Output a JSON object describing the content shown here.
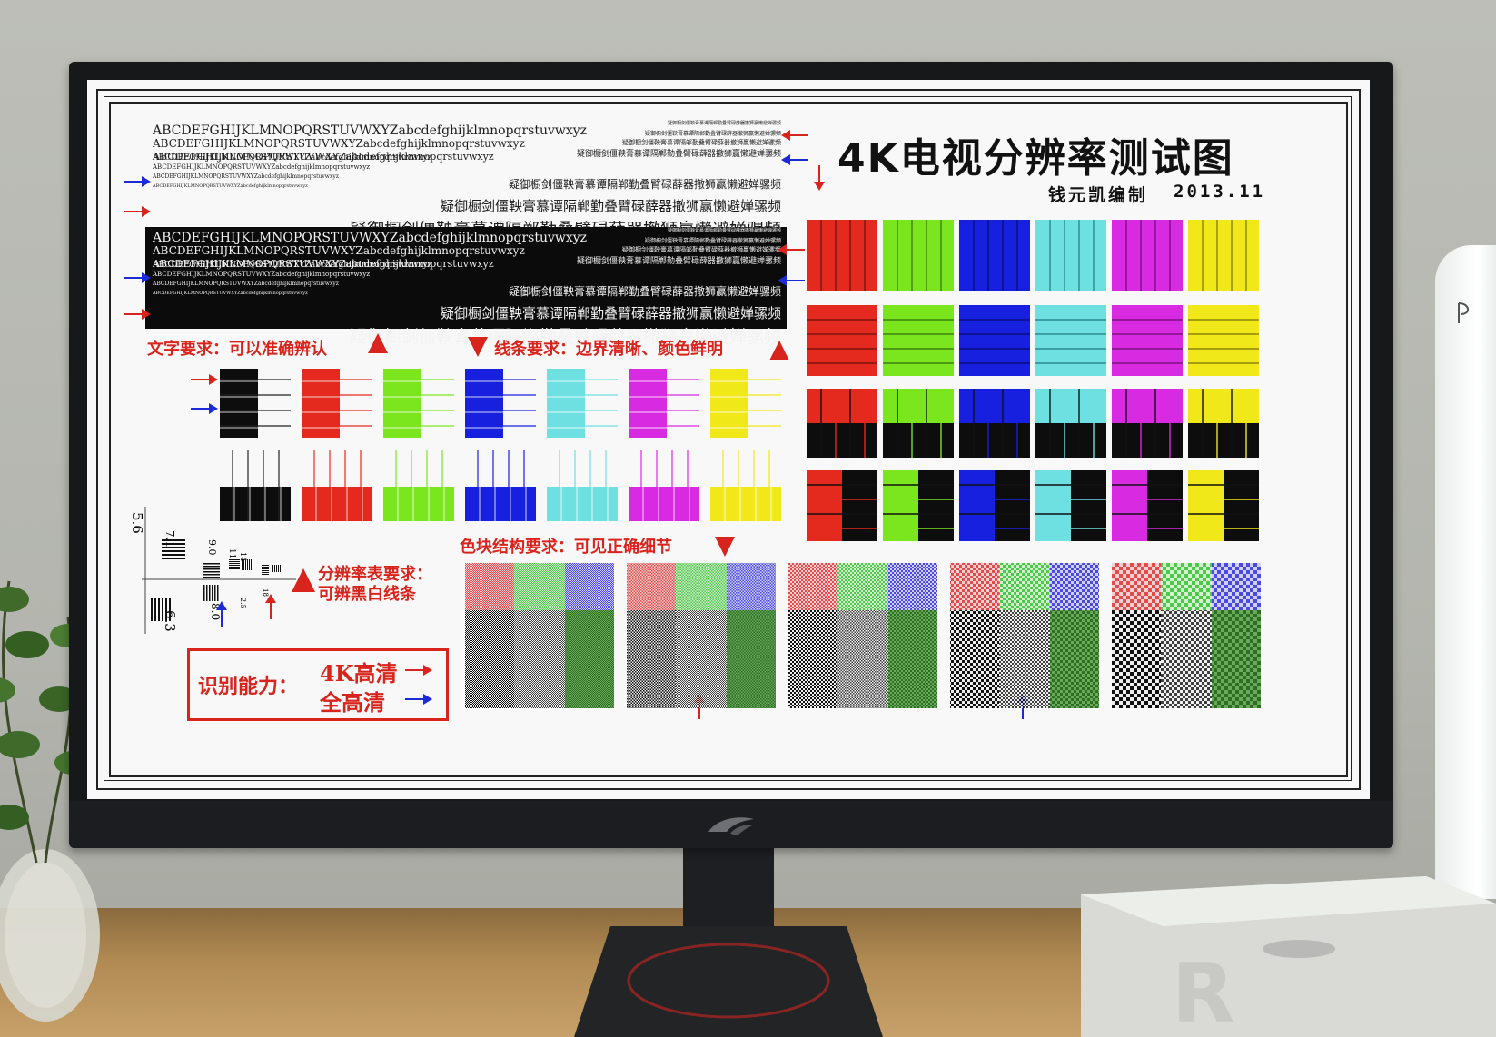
{
  "chart": {
    "title": "4K电视分辨率测试图",
    "author": "钱元凯编制",
    "date": "2013.11"
  },
  "text_test": {
    "latin": "ABCDEFGHIJKLMNOPQRSTUVWXYZabcdefghijklmnopqrstuvwxyz",
    "chinese": "疑御橱剑僵鞅膏慕谭隔郸勤叠臂碌薛器撤狮赢懒避婵骡频"
  },
  "labels": {
    "text_requirement": "文字要求：可以准确辨认",
    "line_requirement": "线条要求：边界清晰、颜色鲜明",
    "block_requirement": "色块结构要求：可见正确细节",
    "resolution_requirement_1": "分辨率表要求：",
    "resolution_requirement_2": "可辨黑白线条",
    "ability_label": "识别能力：",
    "ability_4k": "4K高清",
    "ability_fhd": "全高清"
  },
  "resolution_numbers": [
    "5.6",
    "7.1",
    "9.0",
    "11",
    "14",
    "18",
    "2.5",
    "8.0",
    "6.3"
  ],
  "colors": {
    "red": "#e42a1e",
    "green": "#7be61e",
    "blue": "#1820e0",
    "cyan": "#6ee0e2",
    "magenta": "#d82ae0",
    "yellow": "#f1e81a",
    "black": "#0d0d0d",
    "accent_red": "#d8241c",
    "accent_blue": "#1b2bd8"
  },
  "devices": {
    "monitor_logo": "rog-logo",
    "console": "ps5-console",
    "mini_pc": "mini-pc"
  }
}
